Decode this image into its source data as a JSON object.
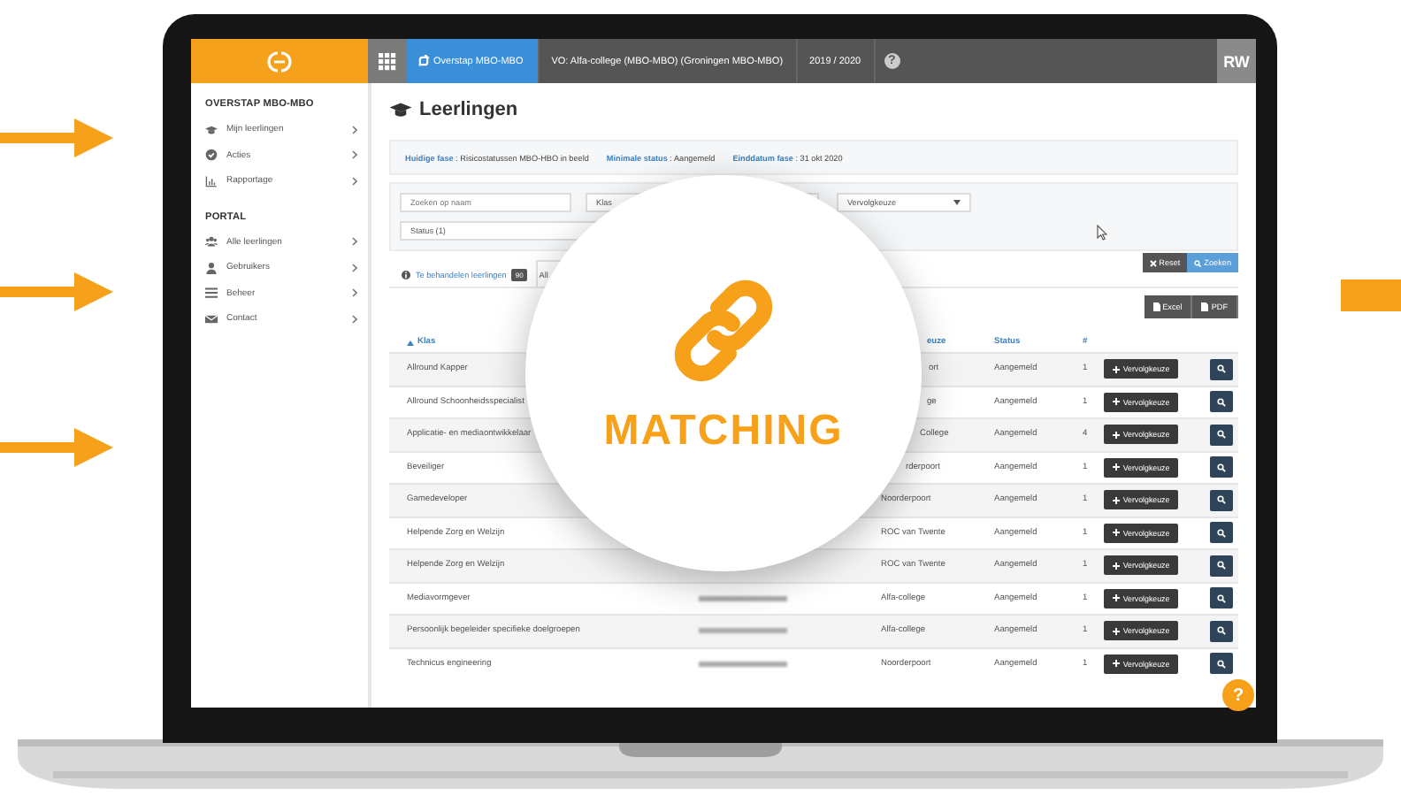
{
  "topbar": {
    "tabs": [
      {
        "label": "Overstap MBO-MBO",
        "selected": true
      },
      {
        "label": "VO: Alfa-college (MBO-MBO) (Groningen MBO-MBO)",
        "selected": false
      },
      {
        "label": "2019 / 2020",
        "selected": false
      }
    ],
    "help": "?",
    "avatar": "RW"
  },
  "sidebar": {
    "sections": [
      {
        "title": "OVERSTAP MBO-MBO",
        "items": [
          "Mijn leerlingen",
          "Acties",
          "Rapportage"
        ]
      },
      {
        "title": "PORTAL",
        "items": [
          "Alle leerlingen",
          "Gebruikers",
          "Beheer",
          "Contact"
        ]
      }
    ]
  },
  "page": {
    "title": "Leerlingen",
    "info": [
      "**Huidige fase** : Risicostatussen MBO-HBO in beeld",
      "**Minimale status** : Aangemeld",
      "**Einddatum fase** : 31 okt 2020"
    ]
  },
  "filters": {
    "rows": [
      [
        {
          "kind": "input",
          "placeholder": "Zoeken op naam"
        },
        {
          "kind": "select",
          "value": "Klas"
        },
        {
          "kind": "select",
          "value": "Vervolgkeuze"
        }
      ],
      [
        {
          "kind": "select",
          "value": "Status (1)"
        }
      ]
    ],
    "buttons": [
      {
        "kind": "reset",
        "label": "Reset"
      },
      {
        "kind": "search",
        "label": "Zoeken"
      }
    ]
  },
  "tabs": [
    {
      "label": "Te behandelen leerlingen",
      "badge": "90",
      "selected": true
    },
    {
      "label": "All",
      "selected": false
    }
  ],
  "exports": [
    "Excel",
    "PDF"
  ],
  "table": {
    "columns": [
      {
        "label": "Klas",
        "sorted": true
      },
      {
        "label": "euze",
        "sorted": false
      },
      {
        "label": "Status",
        "sorted": false
      },
      {
        "label": "#",
        "sorted": false
      }
    ],
    "rows": [
      {
        "klas": "Allround Kapper",
        "name_blurred": false,
        "school": "ort",
        "status": "Aangemeld",
        "count": "1",
        "action": "Vervolgkeuze"
      },
      {
        "klas": "Allround Schoonheidsspecialist",
        "name_blurred": false,
        "school": "ge",
        "status": "Aangemeld",
        "count": "1",
        "action": "Vervolgkeuze"
      },
      {
        "klas": "Applicatie- en mediaontwikkelaar",
        "name_blurred": false,
        "school": "College",
        "status": "Aangemeld",
        "count": "4",
        "action": "Vervolgkeuze"
      },
      {
        "klas": "Beveiliger",
        "name_blurred": false,
        "school": "rderpoort",
        "status": "Aangemeld",
        "count": "1",
        "action": "Vervolgkeuze"
      },
      {
        "klas": "Gamedeveloper",
        "name_blurred": false,
        "school": "Noorderpoort",
        "status": "Aangemeld",
        "count": "1",
        "action": "Vervolgkeuze"
      },
      {
        "klas": "Helpende Zorg en Welzijn",
        "name_blurred": false,
        "school": "ROC van Twente",
        "status": "Aangemeld",
        "count": "1",
        "action": "Vervolgkeuze"
      },
      {
        "klas": "Helpende Zorg en Welzijn",
        "name_blurred": false,
        "school": "ROC van Twente",
        "status": "Aangemeld",
        "count": "1",
        "action": "Vervolgkeuze"
      },
      {
        "klas": "Mediavormgever",
        "name_blurred": true,
        "school": "Alfa-college",
        "status": "Aangemeld",
        "count": "1",
        "action": "Vervolgkeuze"
      },
      {
        "klas": "Persoonlijk begeleider specifieke doelgroepen",
        "name_blurred": true,
        "school": "Alfa-college",
        "status": "Aangemeld",
        "count": "1",
        "action": "Vervolgkeuze"
      },
      {
        "klas": "Technicus engineering",
        "name_blurred": true,
        "school": "Noorderpoort",
        "status": "Aangemeld",
        "count": "1",
        "action": "Vervolgkeuze"
      }
    ]
  },
  "overlay": {
    "title": "MATCHING"
  },
  "help_button": "?"
}
